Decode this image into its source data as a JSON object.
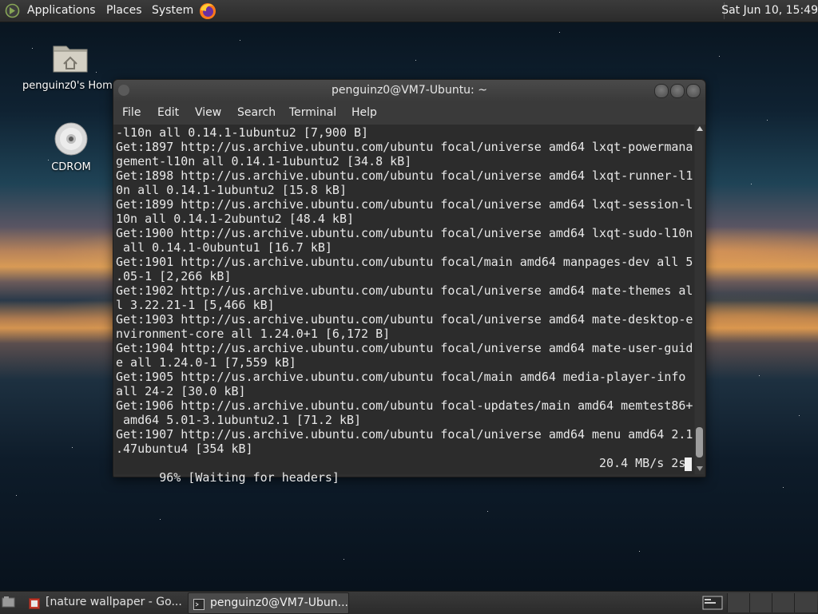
{
  "top_panel": {
    "menus": [
      "Applications",
      "Places",
      "System"
    ],
    "clock": "Sat Jun 10, 15:49",
    "launcher_icon": "firefox-icon",
    "menu_logo_icon": "mate-logo-icon"
  },
  "desktop_icons": [
    {
      "label": "penguinz0's Home",
      "icon": "home-folder-icon"
    },
    {
      "label": "CDROM",
      "icon": "cdrom-icon"
    }
  ],
  "terminal": {
    "title": "penguinz0@VM7-Ubuntu: ~",
    "menu": [
      "File",
      "Edit",
      "View",
      "Search",
      "Terminal",
      "Help"
    ],
    "lines": [
      "-l10n all 0.14.1-1ubuntu2 [7,900 B]",
      "Get:1897 http://us.archive.ubuntu.com/ubuntu focal/universe amd64 lxqt-powermana",
      "gement-l10n all 0.14.1-1ubuntu2 [34.8 kB]",
      "Get:1898 http://us.archive.ubuntu.com/ubuntu focal/universe amd64 lxqt-runner-l1",
      "0n all 0.14.1-1ubuntu2 [15.8 kB]",
      "Get:1899 http://us.archive.ubuntu.com/ubuntu focal/universe amd64 lxqt-session-l",
      "10n all 0.14.1-2ubuntu2 [48.4 kB]",
      "Get:1900 http://us.archive.ubuntu.com/ubuntu focal/universe amd64 lxqt-sudo-l10n",
      " all 0.14.1-0ubuntu1 [16.7 kB]",
      "Get:1901 http://us.archive.ubuntu.com/ubuntu focal/main amd64 manpages-dev all 5",
      ".05-1 [2,266 kB]",
      "Get:1902 http://us.archive.ubuntu.com/ubuntu focal/universe amd64 mate-themes al",
      "l 3.22.21-1 [5,466 kB]",
      "Get:1903 http://us.archive.ubuntu.com/ubuntu focal/universe amd64 mate-desktop-e",
      "nvironment-core all 1.24.0+1 [6,172 B]",
      "Get:1904 http://us.archive.ubuntu.com/ubuntu focal/universe amd64 mate-user-guid",
      "e all 1.24.0-1 [7,559 kB]",
      "Get:1905 http://us.archive.ubuntu.com/ubuntu focal/main amd64 media-player-info",
      "all 24-2 [30.0 kB]",
      "Get:1906 http://us.archive.ubuntu.com/ubuntu focal-updates/main amd64 memtest86+",
      " amd64 5.01-3.1ubuntu2.1 [71.2 kB]",
      "Get:1907 http://us.archive.ubuntu.com/ubuntu focal/universe amd64 menu amd64 2.1",
      ".47ubuntu4 [354 kB]"
    ],
    "status_left": "96% [Waiting for headers]",
    "status_right": "20.4 MB/s 2s"
  },
  "taskbar": {
    "tasks": [
      {
        "label": "[nature wallpaper - Go...",
        "icon": "browser-window-icon",
        "active": false
      },
      {
        "label": "penguinz0@VM7-Ubun...",
        "icon": "terminal-icon",
        "active": true
      }
    ],
    "show_desktop_icon": "show-desktop-icon",
    "tray_icon": "terminal-tray-icon"
  },
  "colors": {
    "panel": "#2f2f2f",
    "terminal_bg": "#2c2c2c",
    "terminal_fg": "#e8e8e8",
    "firefox_orange": "#ff7a1a"
  }
}
